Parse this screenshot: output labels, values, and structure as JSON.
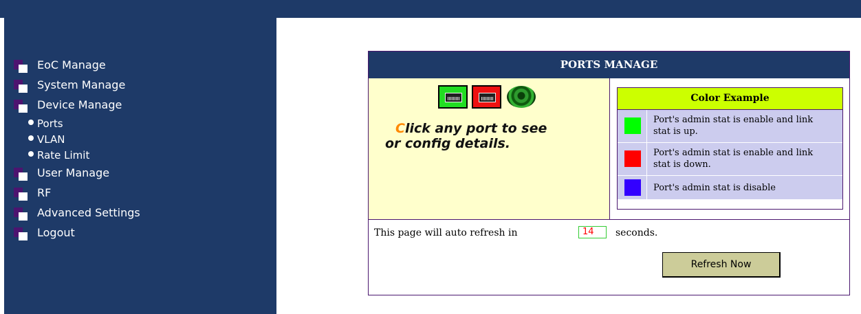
{
  "colors": {
    "sidebar_bg": "#1e3a68",
    "accent_purple": "#4a166e",
    "panel_left_bg": "#ffffcc",
    "color_header_bg": "#ccff00",
    "legend_row_bg": "#ccccee",
    "button_bg": "#cccc99"
  },
  "sidebar": {
    "items": [
      {
        "label": "EoC Manage",
        "icon": "menu-square-icon"
      },
      {
        "label": "System Manage",
        "icon": "menu-square-icon"
      },
      {
        "label": "Device Manage",
        "icon": "menu-square-icon",
        "subitems": [
          {
            "label": "Ports",
            "icon": "bullet-dot-icon"
          },
          {
            "label": "VLAN",
            "icon": "bullet-dot-icon"
          },
          {
            "label": "Rate Limit",
            "icon": "bullet-dot-icon"
          }
        ]
      },
      {
        "label": "User Manage",
        "icon": "menu-square-icon"
      },
      {
        "label": "RF",
        "icon": "menu-square-icon"
      },
      {
        "label": "Advanced Settings",
        "icon": "menu-square-icon"
      },
      {
        "label": "Logout",
        "icon": "menu-square-icon"
      }
    ]
  },
  "panel": {
    "title": "PORTS MANAGE",
    "ports": [
      {
        "name": "ethernet-port-1",
        "status": "link-up",
        "color": "#22dd22"
      },
      {
        "name": "ethernet-port-2",
        "status": "link-down",
        "color": "#ee1111"
      },
      {
        "name": "coax-port",
        "status": "cable",
        "color": "#2e9a2e"
      }
    ],
    "instruction_first": "C",
    "instruction_rest": "lick any port to see or config details.",
    "legend": {
      "title": "Color Example",
      "rows": [
        {
          "color": "#00ff00",
          "text": "Port's admin stat is enable and link stat is up."
        },
        {
          "color": "#ff0000",
          "text": "Port's admin stat is enable and link stat is down."
        },
        {
          "color": "#3300ff",
          "text": "Port's admin stat is disable"
        }
      ]
    },
    "refresh": {
      "prefix": "This page will auto refresh in",
      "countdown": "14",
      "suffix": "seconds.",
      "button_label": "Refresh Now"
    }
  }
}
